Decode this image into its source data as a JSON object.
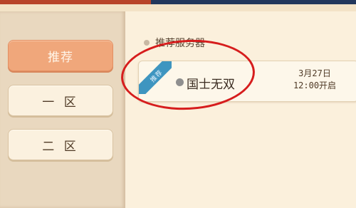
{
  "sidebar": {
    "items": [
      {
        "label": "推荐",
        "active": true
      },
      {
        "label": "一 区",
        "active": false
      },
      {
        "label": "二 区",
        "active": false
      }
    ]
  },
  "main": {
    "section_title": "推荐服务器",
    "servers": [
      {
        "ribbon": "推荐",
        "name": "国士无双",
        "status": "offline",
        "open_date": "3月27日",
        "open_time": "12:00开启"
      }
    ]
  },
  "colors": {
    "accent": "#f0a77b",
    "ribbon": "#3e95c0",
    "highlight": "#d61d1d"
  }
}
